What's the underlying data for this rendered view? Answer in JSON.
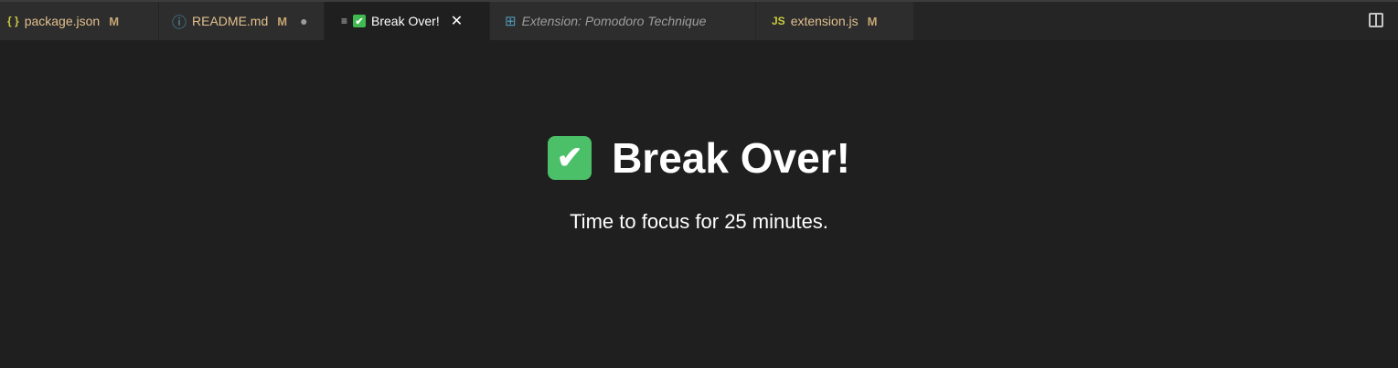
{
  "tabs": [
    {
      "label": "package.json",
      "status": "M",
      "icon": "braces-icon",
      "icon_glyph": "{ }",
      "icon_color": "#cbcb41"
    },
    {
      "label": "README.md",
      "status": "M",
      "icon": "info-icon",
      "icon_glyph": "ⓘ",
      "icon_color": "#519aba",
      "dirty": "●"
    },
    {
      "label": "Break Over!",
      "icon": "check-icon",
      "close": "✕",
      "active": true
    },
    {
      "label": "Extension: Pomodoro Technique",
      "icon": "extensions-icon",
      "icon_glyph": "⊞"
    },
    {
      "label": "extension.js",
      "status": "M",
      "icon": "js-icon",
      "icon_glyph": "JS",
      "icon_color": "#cbcb41"
    }
  ],
  "content": {
    "heading": "Break Over!",
    "check": "✔",
    "message": "Time to focus for 25 minutes."
  }
}
